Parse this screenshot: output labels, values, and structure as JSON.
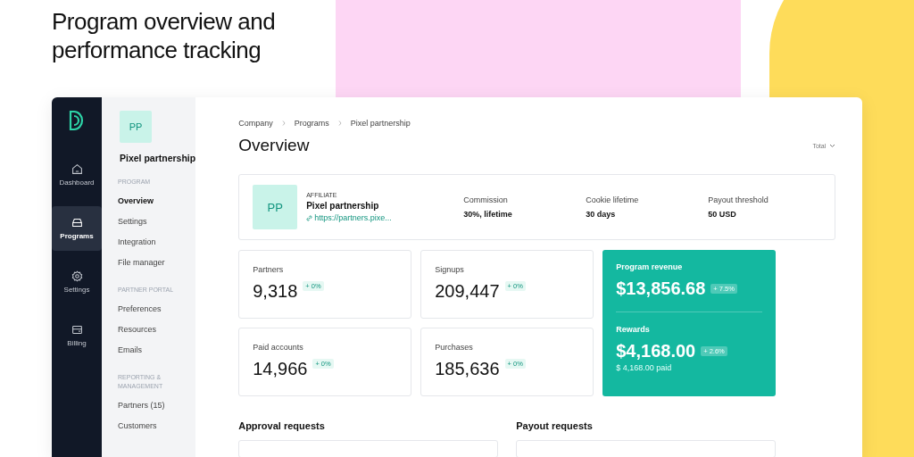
{
  "headline": "Program overview and performance tracking",
  "rail": [
    {
      "kind": "dashboard",
      "label": "Dashboard",
      "selected": false
    },
    {
      "kind": "programs",
      "label": "Programs",
      "selected": true
    },
    {
      "kind": "settings",
      "label": "Settings",
      "selected": false
    },
    {
      "kind": "billing",
      "label": "Billing",
      "selected": false
    }
  ],
  "sidebar": {
    "avatar": "PP",
    "title": "Pixel partnership",
    "sections": [
      {
        "heading": "PROGRAM",
        "items": [
          {
            "label": "Overview",
            "selected": true
          },
          {
            "label": "Settings",
            "selected": false
          },
          {
            "label": "Integration",
            "selected": false
          },
          {
            "label": "File manager",
            "selected": false
          }
        ]
      },
      {
        "heading": "PARTNER PORTAL",
        "items": [
          {
            "label": "Preferences",
            "selected": false
          },
          {
            "label": "Resources",
            "selected": false
          },
          {
            "label": "Emails",
            "selected": false
          }
        ]
      },
      {
        "heading": "REPORTING & MANAGEMENT",
        "items": [
          {
            "label": "Partners (15)",
            "selected": false
          },
          {
            "label": "Customers",
            "selected": false
          }
        ]
      }
    ]
  },
  "breadcrumb": [
    "Company",
    "Programs",
    "Pixel partnership"
  ],
  "title": "Overview",
  "period": "Total",
  "program": {
    "avatar": "PP",
    "type": "AFFILIATE",
    "name": "Pixel partnership",
    "link": "https://partners.pixe...",
    "facts": [
      {
        "label": "Commission",
        "value": "30%, lifetime"
      },
      {
        "label": "Cookie lifetime",
        "value": "30 days"
      },
      {
        "label": "Payout threshold",
        "value": "50 USD"
      }
    ]
  },
  "stats": [
    {
      "label": "Partners",
      "value": "9,318",
      "change": "+ 0%"
    },
    {
      "label": "Signups",
      "value": "209,447",
      "change": "+ 0%"
    },
    {
      "label": "Paid accounts",
      "value": "14,966",
      "change": "+ 0%"
    },
    {
      "label": "Purchases",
      "value": "185,636",
      "change": "+ 0%"
    }
  ],
  "revenue": [
    {
      "label": "Program revenue",
      "value": "$13,856.68",
      "change": "+ 7.5%"
    },
    {
      "label": "Rewards",
      "value": "$4,168.00",
      "change": "+ 2.6%",
      "note": "$ 4,168.00 paid"
    }
  ],
  "sections": [
    "Approval requests",
    "Payout requests"
  ]
}
